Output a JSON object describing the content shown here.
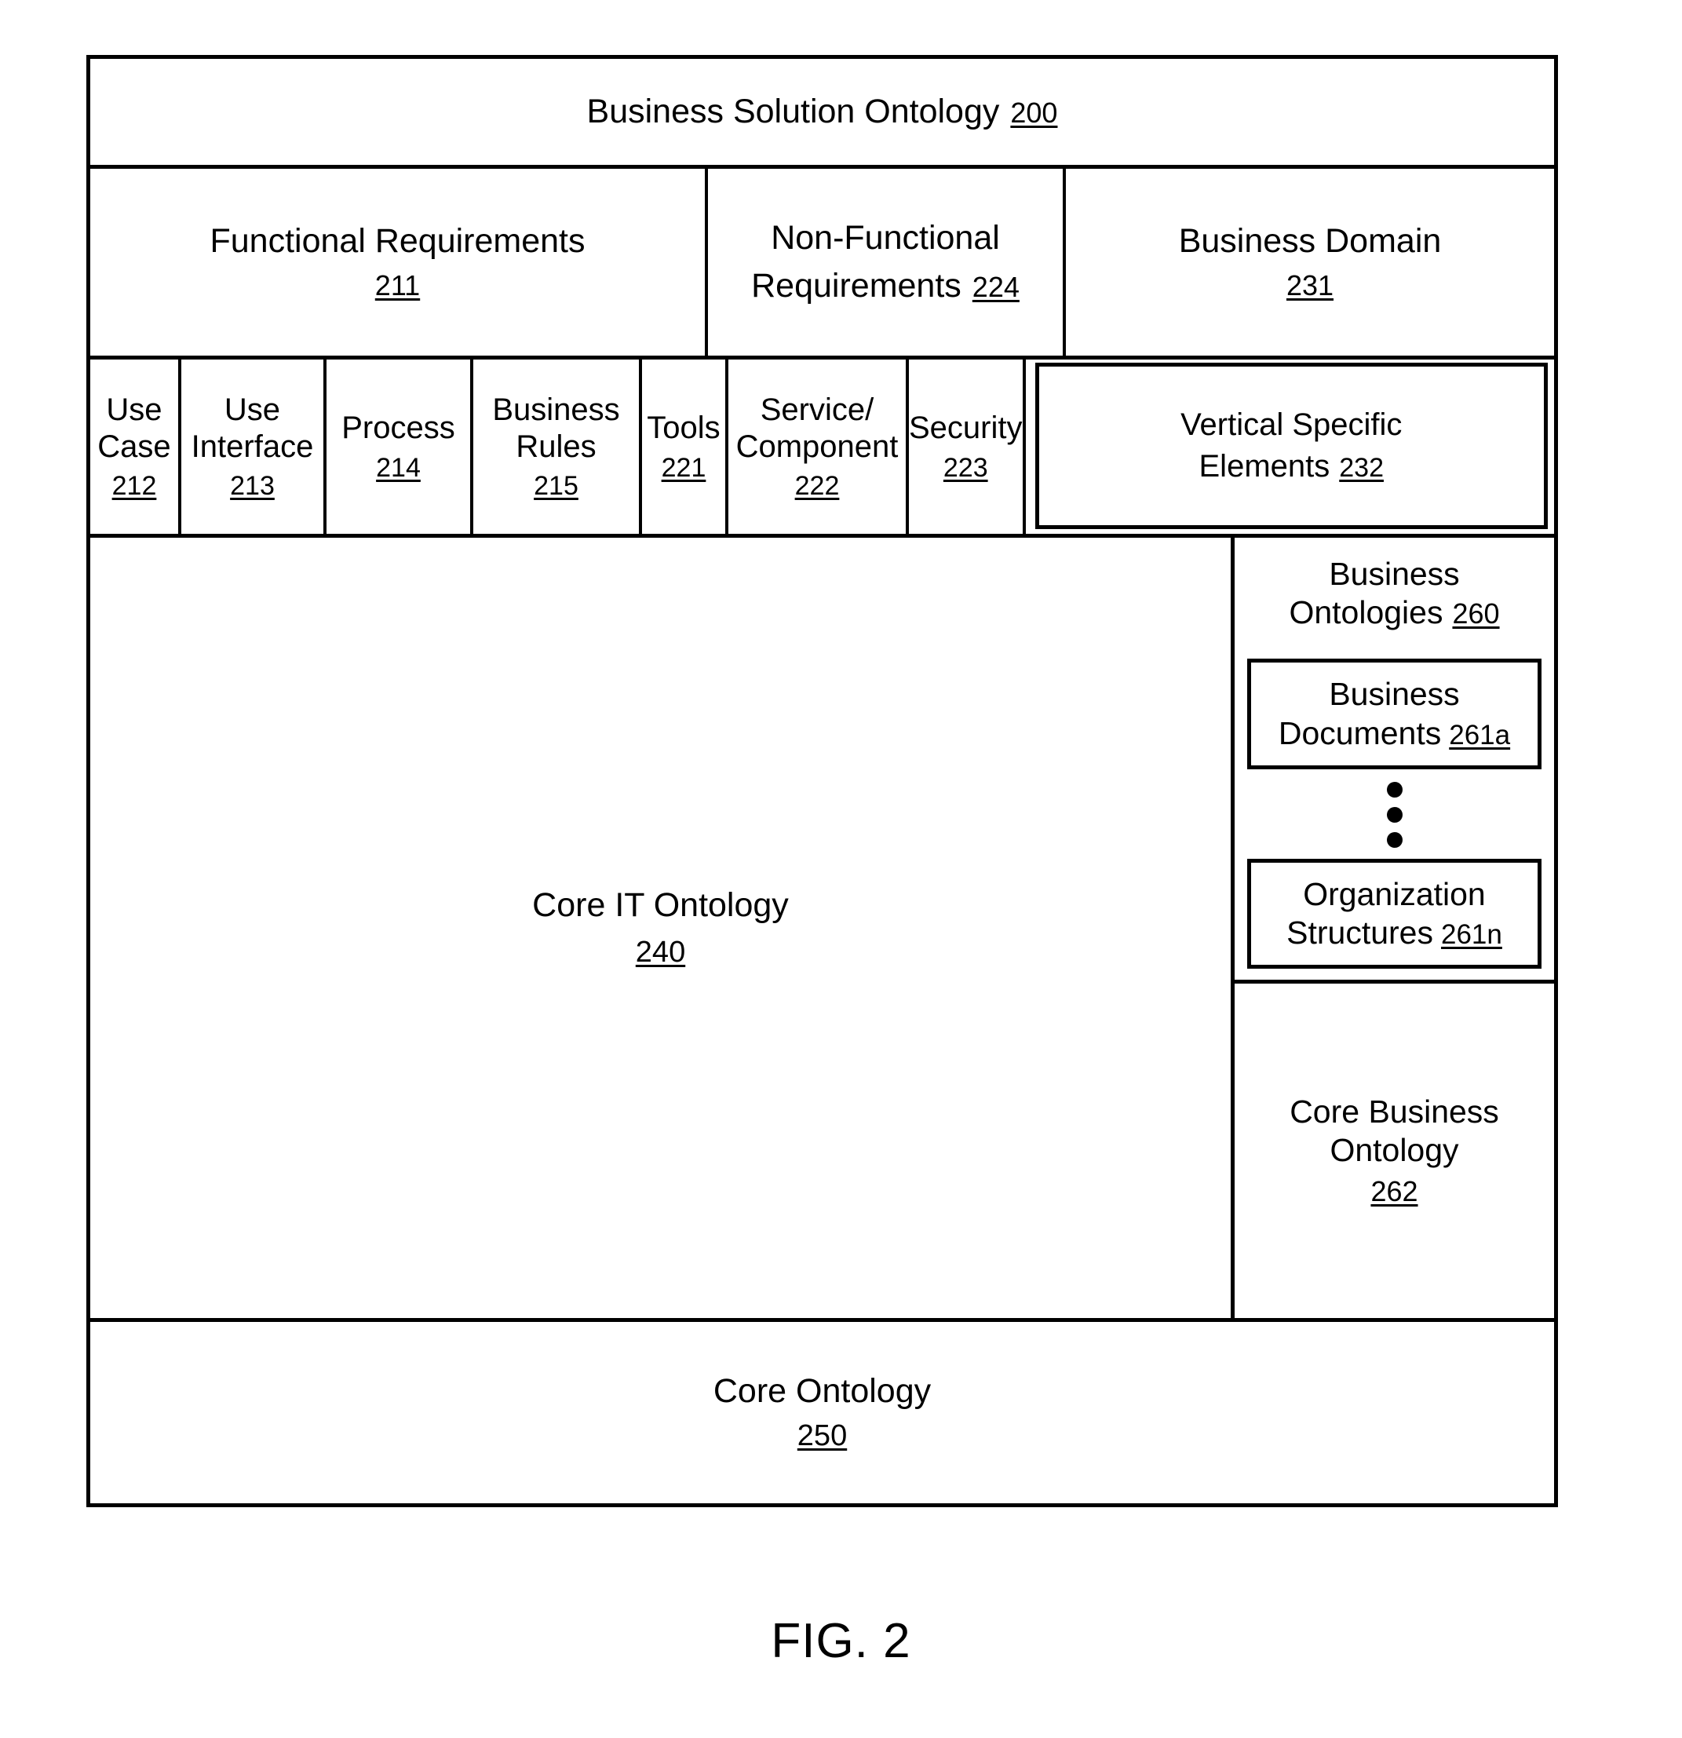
{
  "figure": {
    "caption": "FIG. 2"
  },
  "title": {
    "label": "Business Solution Ontology",
    "ref": "200"
  },
  "groups": {
    "functional": {
      "label": "Functional Requirements",
      "ref": "211"
    },
    "non_functional": {
      "line1": "Non-Functional",
      "line2": "Requirements",
      "ref": "224"
    },
    "business_domain": {
      "label": "Business Domain",
      "ref": "231"
    }
  },
  "sub_elements": [
    {
      "line1": "Use",
      "line2": "Case",
      "ref": "212"
    },
    {
      "line1": "Use",
      "line2": "Interface",
      "ref": "213"
    },
    {
      "line1": "Process",
      "line2": "",
      "ref": "214"
    },
    {
      "line1": "Business",
      "line2": "Rules",
      "ref": "215"
    },
    {
      "line1": "Tools",
      "line2": "",
      "ref": "221"
    },
    {
      "line1": "Service/",
      "line2": "Component",
      "ref": "222"
    },
    {
      "line1": "Security",
      "line2": "",
      "ref": "223"
    },
    {
      "line1": "Vertical Specific",
      "line2": "Elements",
      "ref": "232"
    }
  ],
  "core_it_ontology": {
    "label": "Core IT Ontology",
    "ref": "240"
  },
  "business_ontologies": {
    "line1": "Business",
    "line2": "Ontologies",
    "ref": "260",
    "boxes": [
      {
        "line1": "Business",
        "line2": "Documents",
        "ref": "261a"
      },
      {
        "line1": "Organization",
        "line2": "Structures",
        "ref": "261n"
      }
    ],
    "ellipsis": "vertical-three-dots"
  },
  "core_business_ontology": {
    "line1": "Core Business",
    "line2": "Ontology",
    "ref": "262"
  },
  "core_ontology": {
    "label": "Core Ontology",
    "ref": "250"
  },
  "colors": {
    "ink": "#000000",
    "background": "#ffffff"
  }
}
